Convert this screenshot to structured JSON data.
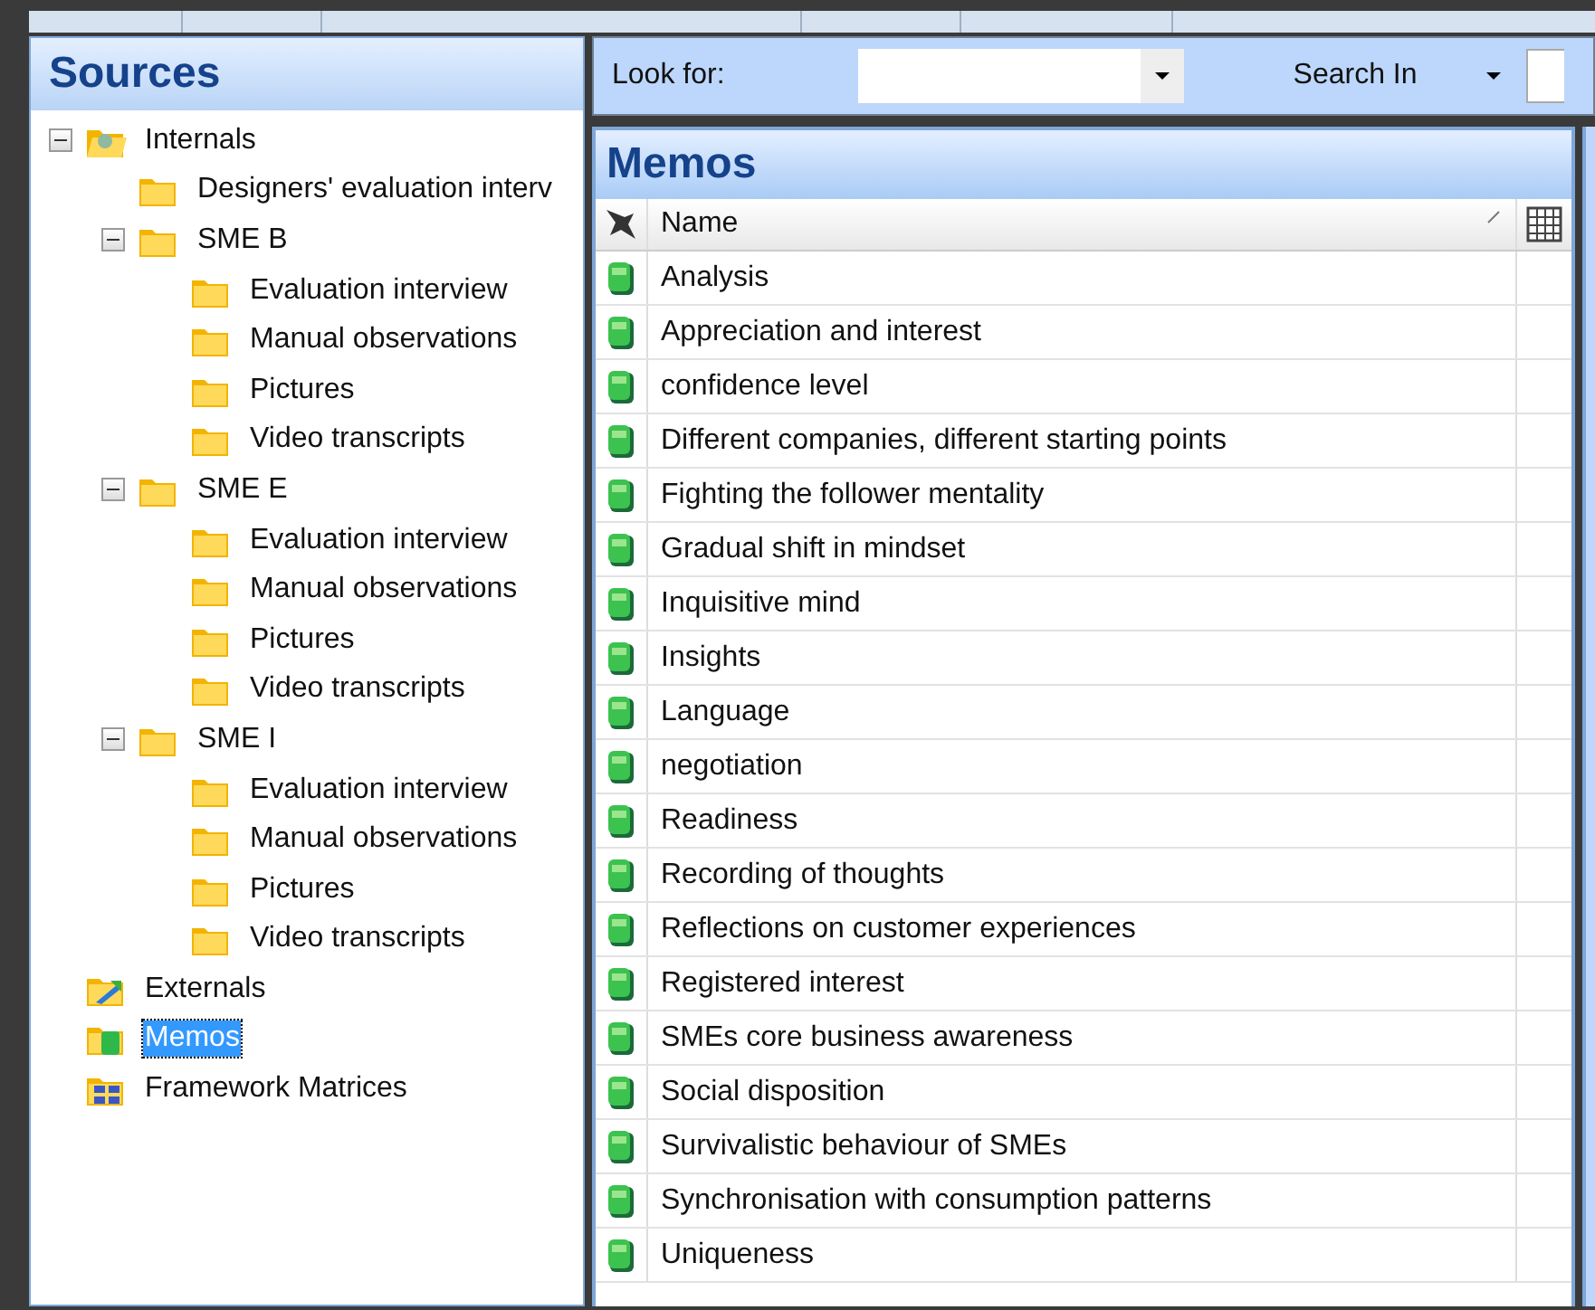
{
  "sources": {
    "title": "Sources",
    "tree": [
      {
        "label": "Internals",
        "kind": "internals",
        "expanded": true,
        "selected": false,
        "children": [
          {
            "label": "Designers' evaluation interv",
            "kind": "folder",
            "selected": false
          },
          {
            "label": "SME B",
            "kind": "folder",
            "expanded": true,
            "selected": false,
            "children": [
              {
                "label": "Evaluation interview",
                "kind": "folder",
                "selected": false
              },
              {
                "label": "Manual observations",
                "kind": "folder",
                "selected": false
              },
              {
                "label": "Pictures",
                "kind": "folder",
                "selected": false
              },
              {
                "label": "Video transcripts",
                "kind": "folder",
                "selected": false
              }
            ]
          },
          {
            "label": "SME E",
            "kind": "folder",
            "expanded": true,
            "selected": false,
            "children": [
              {
                "label": "Evaluation interview",
                "kind": "folder",
                "selected": false
              },
              {
                "label": "Manual observations",
                "kind": "folder",
                "selected": false
              },
              {
                "label": "Pictures",
                "kind": "folder",
                "selected": false
              },
              {
                "label": "Video transcripts",
                "kind": "folder",
                "selected": false
              }
            ]
          },
          {
            "label": "SME I",
            "kind": "folder",
            "expanded": true,
            "selected": false,
            "children": [
              {
                "label": "Evaluation interview",
                "kind": "folder",
                "selected": false
              },
              {
                "label": "Manual observations",
                "kind": "folder",
                "selected": false
              },
              {
                "label": "Pictures",
                "kind": "folder",
                "selected": false
              },
              {
                "label": "Video transcripts",
                "kind": "folder",
                "selected": false
              }
            ]
          }
        ]
      },
      {
        "label": "Externals",
        "kind": "externals",
        "selected": false
      },
      {
        "label": "Memos",
        "kind": "memos",
        "selected": true
      },
      {
        "label": "Framework Matrices",
        "kind": "matrices",
        "selected": false
      }
    ]
  },
  "toolbar": {
    "look_for_label": "Look for:",
    "search_in_label": "Search In"
  },
  "memos": {
    "title": "Memos",
    "columns": [
      "Name"
    ],
    "rows": [
      "Analysis",
      "Appreciation and interest",
      "confidence level",
      "Different companies, different starting points",
      "Fighting the follower mentality",
      "Gradual shift in mindset",
      "Inquisitive mind",
      "Insights",
      "Language",
      "negotiation",
      "Readiness",
      "Recording of thoughts",
      "Reflections on customer experiences",
      "Registered interest",
      "SMEs core business awareness",
      "Social disposition",
      "Survivalistic behaviour of SMEs",
      "Synchronisation with consumption patterns",
      "Uniqueness"
    ]
  }
}
